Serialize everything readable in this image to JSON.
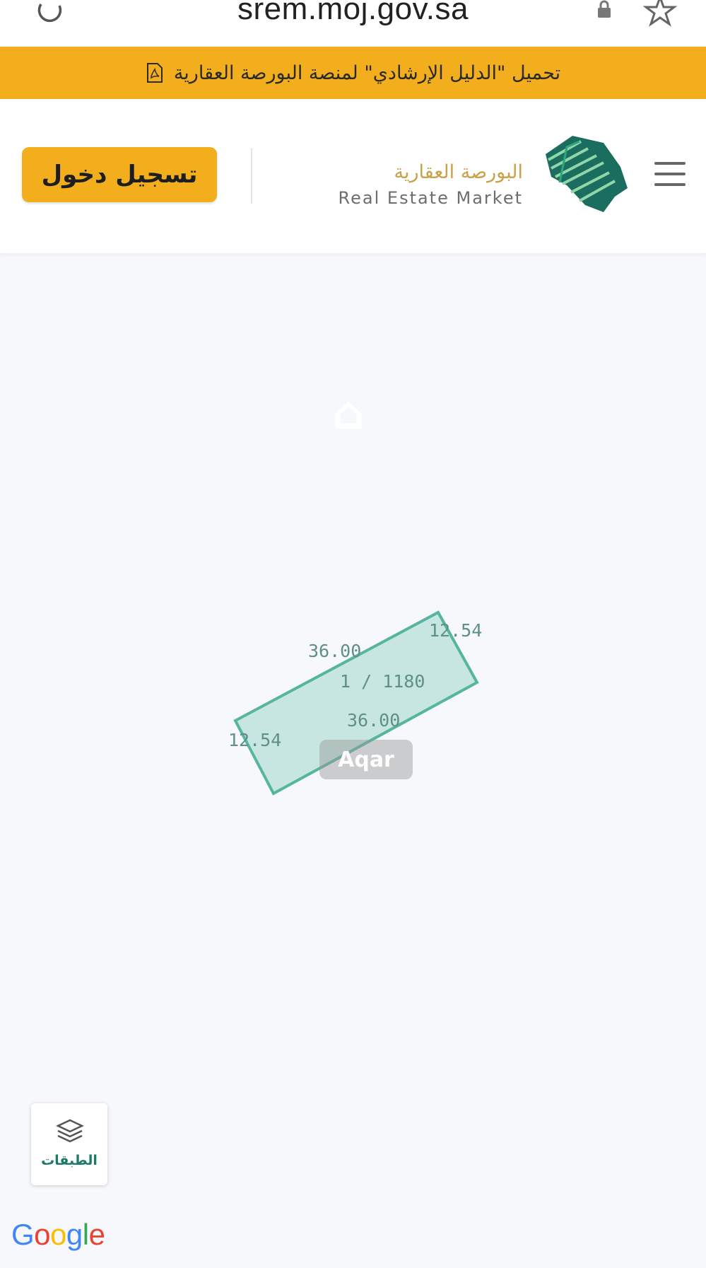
{
  "browser": {
    "url": "srem.moj.gov.sa"
  },
  "banner": {
    "text": "تحميل \"الدليل الإرشادي\" لمنصة البورصة العقارية"
  },
  "header": {
    "login_label": "تسجيل دخول",
    "brand_arabic": "البورصة العقارية",
    "brand_english": "Real Estate Market"
  },
  "map": {
    "parcel": {
      "id_label": "1 / 1180",
      "side_top": "36.00",
      "side_bottom": "36.00",
      "side_right": "12.54",
      "side_left": "12.54"
    },
    "layers_label": "الطبقات",
    "watermark": "Aqar"
  },
  "google": {
    "letters": [
      {
        "ch": "G",
        "color": "#4285F4"
      },
      {
        "ch": "o",
        "color": "#EA4335"
      },
      {
        "ch": "o",
        "color": "#FBBC05"
      },
      {
        "ch": "g",
        "color": "#4285F4"
      },
      {
        "ch": "l",
        "color": "#34A853"
      },
      {
        "ch": "e",
        "color": "#EA4335"
      }
    ]
  },
  "colors": {
    "accent_yellow": "#f2ae1c",
    "brand_gold": "#c9a24a",
    "parcel_fill": "#bfe3dc",
    "parcel_stroke": "#55b59f",
    "brand_green": "#1d7a68"
  },
  "icons": [
    "reload-icon",
    "lock-icon",
    "star-icon",
    "pdf-icon",
    "logo-mark-icon",
    "menu-icon",
    "layers-icon"
  ]
}
